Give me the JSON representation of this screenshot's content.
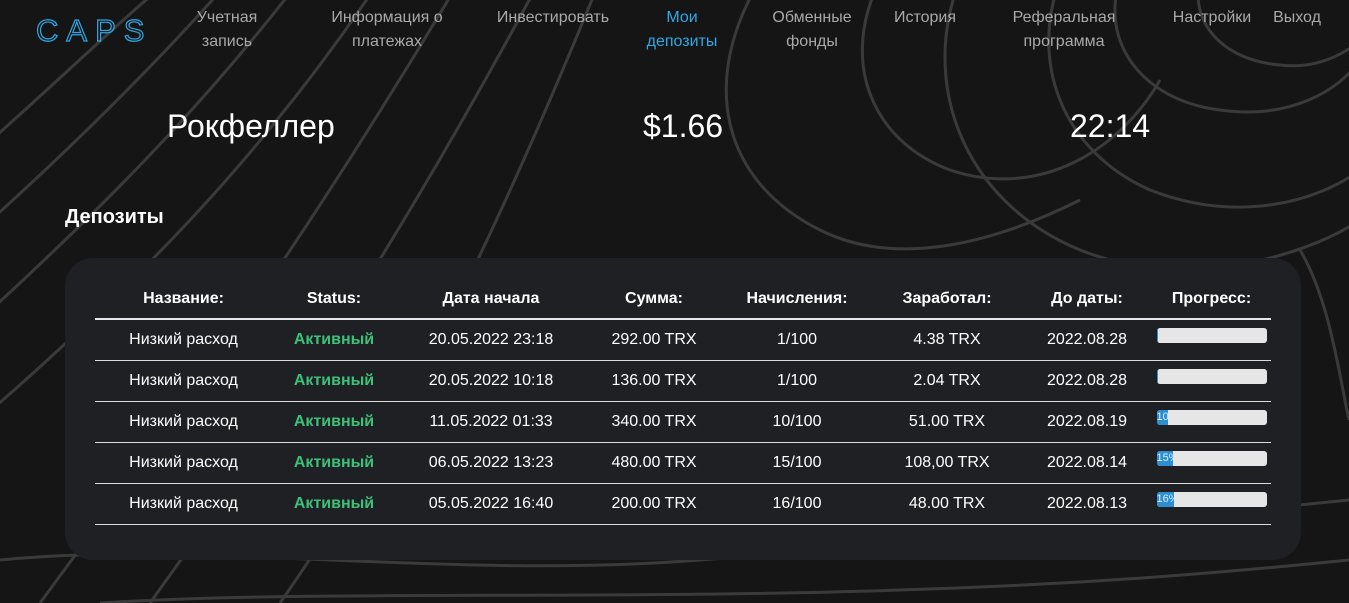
{
  "app": {
    "logo_text": "CAPS"
  },
  "nav": [
    {
      "label": "Учетная\nзапись",
      "active": false
    },
    {
      "label": "Информация о\nплатежах",
      "active": false
    },
    {
      "label": "Инвестировать",
      "active": false
    },
    {
      "label": "Мои\nдепозиты",
      "active": true
    },
    {
      "label": "Обменные\nфонды",
      "active": false
    },
    {
      "label": "История",
      "active": false
    },
    {
      "label": "Реферальная\nпрограмма",
      "active": false
    },
    {
      "label": "Настройки",
      "active": false
    },
    {
      "label": "Выход",
      "active": false
    }
  ],
  "stats": {
    "user_name": "Рокфеллер",
    "balance": "$1.66",
    "time": "22:14"
  },
  "deposits": {
    "title": "Депозиты",
    "headers": [
      "Название:",
      "Status:",
      "Дата начала",
      "Сумма:",
      "Начисления:",
      "Заработал:",
      "До даты:",
      "Прогресс:"
    ],
    "rows": [
      {
        "name": "Низкий расход",
        "status": "Активный",
        "start": "20.05.2022 23:18",
        "amount": "292.00 TRX",
        "accruals": "1/100",
        "earned": "4.38 TRX",
        "until": "2022.08.28",
        "progress": 1,
        "progress_label": ""
      },
      {
        "name": "Низкий расход",
        "status": "Активный",
        "start": "20.05.2022 10:18",
        "amount": "136.00 TRX",
        "accruals": "1/100",
        "earned": "2.04 TRX",
        "until": "2022.08.28",
        "progress": 1,
        "progress_label": ""
      },
      {
        "name": "Низкий расход",
        "status": "Активный",
        "start": "11.05.2022 01:33",
        "amount": "340.00 TRX",
        "accruals": "10/100",
        "earned": "51.00 TRX",
        "until": "2022.08.19",
        "progress": 10,
        "progress_label": "10"
      },
      {
        "name": "Низкий расход",
        "status": "Активный",
        "start": "06.05.2022 13:23",
        "amount": "480.00 TRX",
        "accruals": "15/100",
        "earned": "108,00 TRX",
        "until": "2022.08.14",
        "progress": 15,
        "progress_label": "15%"
      },
      {
        "name": "Низкий расход",
        "status": "Активный",
        "start": "05.05.2022 16:40",
        "amount": "200.00 TRX",
        "accruals": "16/100",
        "earned": "48.00 TRX",
        "until": "2022.08.13",
        "progress": 16,
        "progress_label": "16%"
      }
    ]
  },
  "colors": {
    "accent": "#2ea8e6",
    "status_active": "#3cc179",
    "progress_fill": "#2b8fd1",
    "card_bg": "#1f2024"
  }
}
